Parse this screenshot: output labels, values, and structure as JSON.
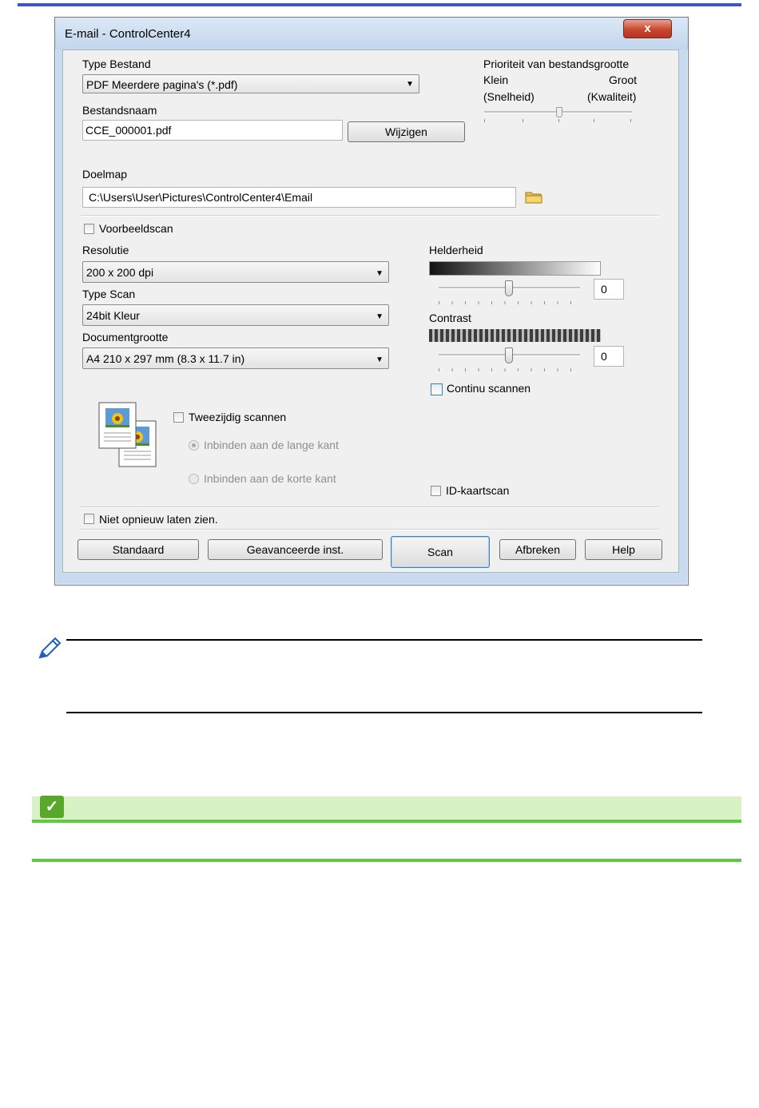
{
  "window": {
    "title": "E-mail - ControlCenter4",
    "close_glyph": "x"
  },
  "file": {
    "type_label": "Type Bestand",
    "type_value": "PDF Meerdere pagina's (*.pdf)",
    "name_label": "Bestandsnaam",
    "name_value": "CCE_000001.pdf",
    "change_button": "Wijzigen",
    "priority_title": "Prioriteit van bestandsgrootte",
    "priority_small": "Klein",
    "priority_large": "Groot",
    "priority_speed": "(Snelheid)",
    "priority_quality": "(Kwaliteit)"
  },
  "destination": {
    "label": "Doelmap",
    "path": "C:\\Users\\User\\Pictures\\ControlCenter4\\Email"
  },
  "preview_scan": {
    "label": "Voorbeeldscan",
    "checked": false
  },
  "resolution": {
    "label": "Resolutie",
    "value": "200 x 200 dpi"
  },
  "scan_type": {
    "label": "Type Scan",
    "value": "24bit Kleur"
  },
  "document_size": {
    "label": "Documentgrootte",
    "value": "A4 210 x 297 mm (8.3 x 11.7 in)"
  },
  "brightness": {
    "label": "Helderheid",
    "value": "0"
  },
  "contrast": {
    "label": "Contrast",
    "value": "0"
  },
  "continuous_scan": {
    "label": "Continu scannen",
    "checked": false
  },
  "duplex": {
    "label": "Tweezijdig scannen",
    "checked": false,
    "long_edge": "Inbinden aan de lange kant",
    "short_edge": "Inbinden aan de korte kant"
  },
  "id_card_scan": {
    "label": "ID-kaartscan",
    "checked": false
  },
  "dont_show_again": {
    "label": "Niet opnieuw laten zien.",
    "checked": false
  },
  "buttons": {
    "default": "Standaard",
    "advanced": "Geavanceerde inst.",
    "scan": "Scan",
    "cancel": "Afbreken",
    "help": "Help"
  },
  "icons": {
    "folder": "folder-icon",
    "note": "pencil-icon",
    "check": "checkmark-icon"
  },
  "colors": {
    "top_bar": "#3b56c9",
    "green_bar": "#d8f2c6",
    "green_line": "#62c843"
  }
}
